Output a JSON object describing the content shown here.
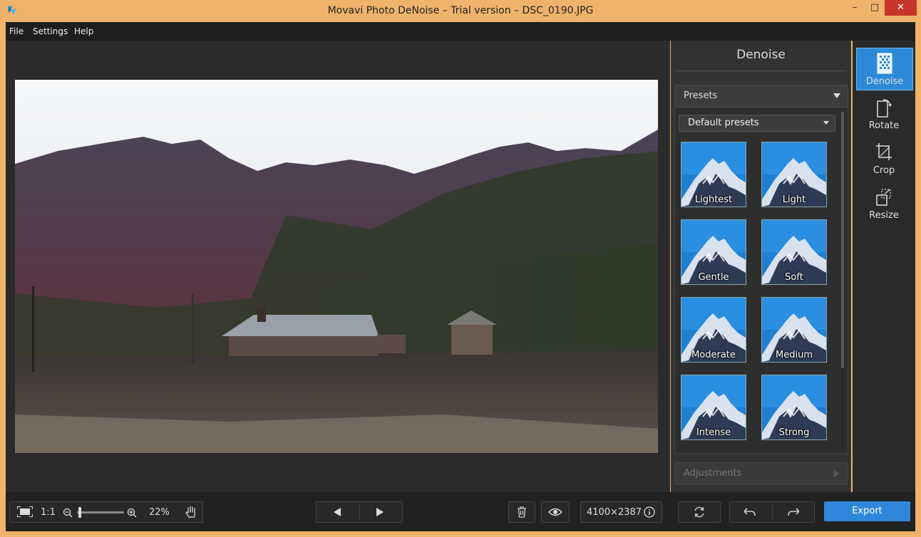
{
  "window": {
    "title": "Movavi Photo DeNoise – Trial version – DSC_0190.JPG",
    "minimize": "–",
    "maximize": "□",
    "close": "✕"
  },
  "menu": {
    "items": [
      "File",
      "Settings",
      "Help"
    ]
  },
  "panel": {
    "title": "Denoise",
    "presets_label": "Presets",
    "dropdown_value": "Default presets",
    "adjustments_label": "Adjustments",
    "presets": [
      "Lightest",
      "Light",
      "Gentle",
      "Soft",
      "Moderate",
      "Medium",
      "Intense",
      "Strong"
    ]
  },
  "tools": [
    {
      "label": "Denoise",
      "icon": "denoise-icon",
      "active": true
    },
    {
      "label": "Rotate",
      "icon": "rotate-icon",
      "active": false
    },
    {
      "label": "Crop",
      "icon": "crop-icon",
      "active": false
    },
    {
      "label": "Resize",
      "icon": "resize-icon",
      "active": false
    }
  ],
  "bottom": {
    "actual_size": "1:1",
    "zoom_percent": "22%",
    "zoom_slider_value": 0.03,
    "image_size": "4100×2387",
    "export_label": "Export"
  },
  "colors": {
    "accent": "#2f87dc",
    "frame": "#f0b36b",
    "close": "#c7352a"
  }
}
